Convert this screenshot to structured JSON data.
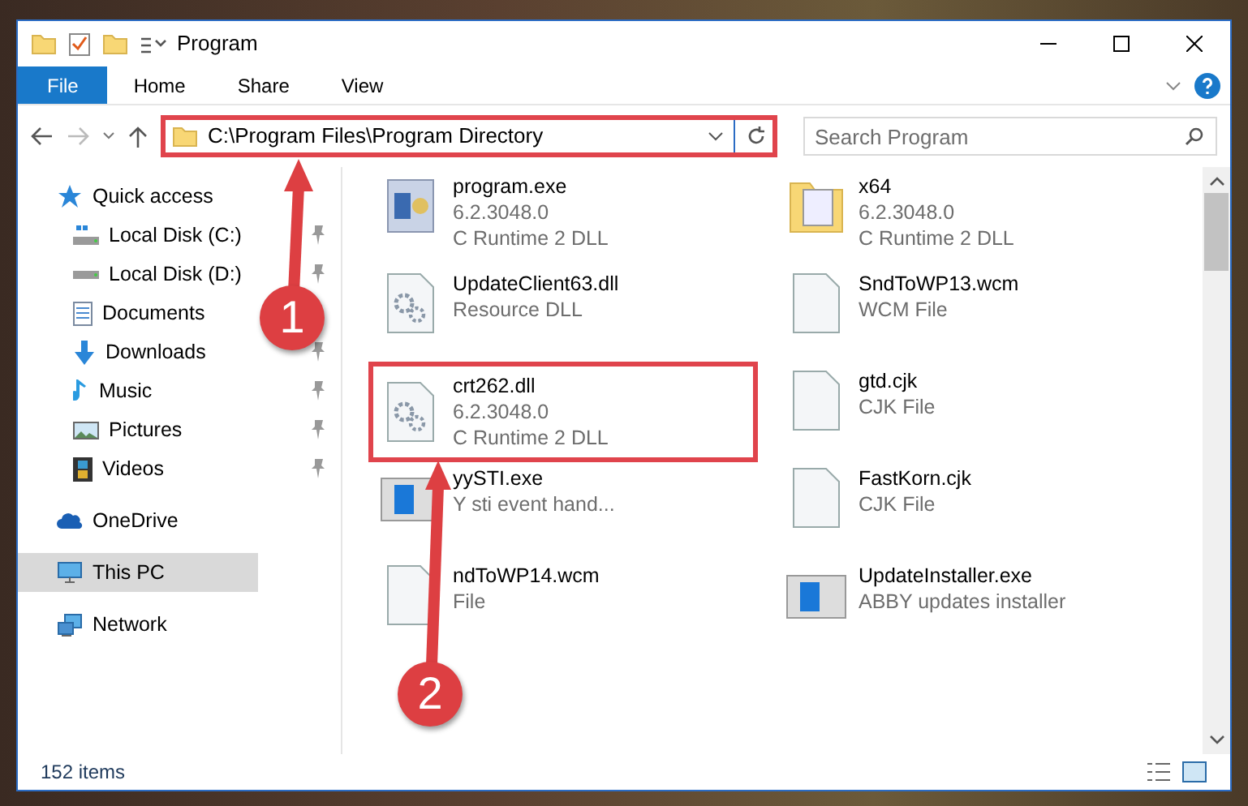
{
  "window": {
    "title": "Program"
  },
  "ribbon": {
    "tabs": [
      {
        "label": "File",
        "selected": true
      },
      {
        "label": "Home",
        "selected": false
      },
      {
        "label": "Share",
        "selected": false
      },
      {
        "label": "View",
        "selected": false
      }
    ]
  },
  "address": {
    "path": "C:\\Program Files\\Program Directory",
    "highlighted": true
  },
  "search": {
    "placeholder": "Search Program"
  },
  "sidebar": {
    "items": [
      {
        "label": "Quick access",
        "selected": false,
        "children": [
          {
            "label": "Local Disk (C:)",
            "pinned": true,
            "selected": false
          },
          {
            "label": "Local Disk (D:)",
            "pinned": true,
            "selected": false
          },
          {
            "label": "Documents",
            "pinned": false,
            "selected": false
          },
          {
            "label": "Downloads",
            "pinned": true,
            "selected": false
          },
          {
            "label": "Music",
            "pinned": true,
            "selected": false
          },
          {
            "label": "Pictures",
            "pinned": true,
            "selected": false
          },
          {
            "label": "Videos",
            "pinned": true,
            "selected": false
          }
        ]
      },
      {
        "label": "OneDrive",
        "selected": false
      },
      {
        "label": "This PC",
        "selected": true
      },
      {
        "label": "Network",
        "selected": false
      }
    ]
  },
  "files": [
    {
      "kind": "exe",
      "name": "program.exe",
      "lines": [
        "6.2.3048.0",
        "C Runtime 2 DLL"
      ],
      "highlighted": false
    },
    {
      "kind": "folder",
      "name": "x64",
      "lines": [
        "6.2.3048.0",
        "C Runtime 2 DLL"
      ],
      "highlighted": false
    },
    {
      "kind": "dll",
      "name": "UpdateClient63.dll",
      "lines": [
        "Resource DLL"
      ],
      "highlighted": false
    },
    {
      "kind": "file",
      "name": "SndToWP13.wcm",
      "lines": [
        "WCM File"
      ],
      "highlighted": false
    },
    {
      "kind": "dll",
      "name": "crt262.dll",
      "lines": [
        "6.2.3048.0",
        "C Runtime 2 DLL"
      ],
      "highlighted": true
    },
    {
      "kind": "file",
      "name": "gtd.cjk",
      "lines": [
        "CJK File"
      ],
      "highlighted": false
    },
    {
      "kind": "app",
      "name": "yySTI.exe",
      "lines": [
        "Y sti event hand..."
      ],
      "highlighted": false
    },
    {
      "kind": "file",
      "name": "FastKorn.cjk",
      "lines": [
        "CJK File"
      ],
      "highlighted": false
    },
    {
      "kind": "file",
      "name": "ndToWP14.wcm",
      "lines": [
        "File"
      ],
      "highlighted": false
    },
    {
      "kind": "app",
      "name": "UpdateInstaller.exe",
      "lines": [
        "ABBY updates installer"
      ],
      "highlighted": false
    }
  ],
  "status_bar": {
    "count": "152 items"
  },
  "annotations": [
    {
      "label": "1"
    },
    {
      "label": "2"
    }
  ]
}
